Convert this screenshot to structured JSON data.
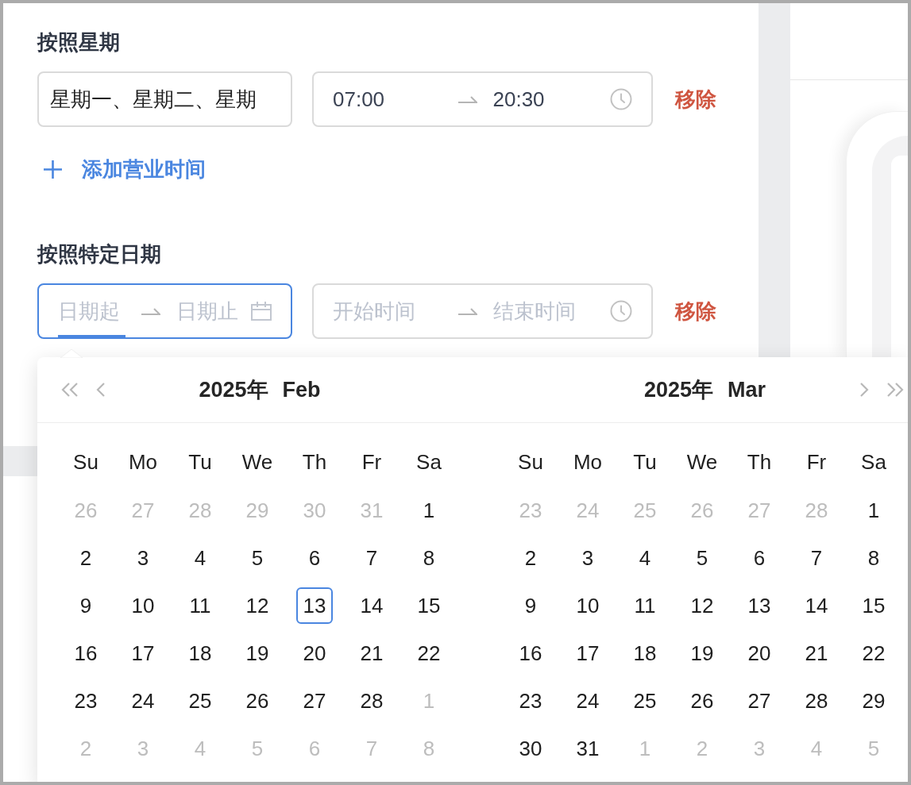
{
  "weekly_hours": {
    "label": "按照星期",
    "days_select": {
      "value": "星期一、星期二、星期"
    },
    "time_range": {
      "focused": false,
      "start": {
        "value": "07:00",
        "active": false
      },
      "end": {
        "value": "20:30",
        "active": false
      }
    },
    "remove": "移除"
  },
  "add_button": {
    "label": "添加营业时间"
  },
  "date_hours": {
    "label": "按照特定日期",
    "date_range": {
      "focused": true,
      "start": {
        "placeholder": "日期起",
        "active": true
      },
      "end": {
        "placeholder": "日期止",
        "active": false
      }
    },
    "time_range": {
      "focused": false,
      "start": {
        "placeholder": "开始时间",
        "active": false
      },
      "end": {
        "placeholder": "结束时间",
        "active": false
      }
    },
    "remove": "移除"
  },
  "calendar": {
    "panels": [
      {
        "year": "2025年",
        "month": "Feb",
        "weekdays": [
          "Su",
          "Mo",
          "Tu",
          "We",
          "Th",
          "Fr",
          "Sa"
        ],
        "weeks": [
          {
            "days": [
              {
                "day": "26",
                "in_month": false,
                "today": false
              },
              {
                "day": "27",
                "in_month": false,
                "today": false
              },
              {
                "day": "28",
                "in_month": false,
                "today": false
              },
              {
                "day": "29",
                "in_month": false,
                "today": false
              },
              {
                "day": "30",
                "in_month": false,
                "today": false
              },
              {
                "day": "31",
                "in_month": false,
                "today": false
              },
              {
                "day": "1",
                "in_month": true,
                "today": false
              }
            ]
          },
          {
            "days": [
              {
                "day": "2",
                "in_month": true,
                "today": false
              },
              {
                "day": "3",
                "in_month": true,
                "today": false
              },
              {
                "day": "4",
                "in_month": true,
                "today": false
              },
              {
                "day": "5",
                "in_month": true,
                "today": false
              },
              {
                "day": "6",
                "in_month": true,
                "today": false
              },
              {
                "day": "7",
                "in_month": true,
                "today": false
              },
              {
                "day": "8",
                "in_month": true,
                "today": false
              }
            ]
          },
          {
            "days": [
              {
                "day": "9",
                "in_month": true,
                "today": false
              },
              {
                "day": "10",
                "in_month": true,
                "today": false
              },
              {
                "day": "11",
                "in_month": true,
                "today": false
              },
              {
                "day": "12",
                "in_month": true,
                "today": false
              },
              {
                "day": "13",
                "in_month": true,
                "today": true
              },
              {
                "day": "14",
                "in_month": true,
                "today": false
              },
              {
                "day": "15",
                "in_month": true,
                "today": false
              }
            ]
          },
          {
            "days": [
              {
                "day": "16",
                "in_month": true,
                "today": false
              },
              {
                "day": "17",
                "in_month": true,
                "today": false
              },
              {
                "day": "18",
                "in_month": true,
                "today": false
              },
              {
                "day": "19",
                "in_month": true,
                "today": false
              },
              {
                "day": "20",
                "in_month": true,
                "today": false
              },
              {
                "day": "21",
                "in_month": true,
                "today": false
              },
              {
                "day": "22",
                "in_month": true,
                "today": false
              }
            ]
          },
          {
            "days": [
              {
                "day": "23",
                "in_month": true,
                "today": false
              },
              {
                "day": "24",
                "in_month": true,
                "today": false
              },
              {
                "day": "25",
                "in_month": true,
                "today": false
              },
              {
                "day": "26",
                "in_month": true,
                "today": false
              },
              {
                "day": "27",
                "in_month": true,
                "today": false
              },
              {
                "day": "28",
                "in_month": true,
                "today": false
              },
              {
                "day": "1",
                "in_month": false,
                "today": false
              }
            ]
          },
          {
            "days": [
              {
                "day": "2",
                "in_month": false,
                "today": false
              },
              {
                "day": "3",
                "in_month": false,
                "today": false
              },
              {
                "day": "4",
                "in_month": false,
                "today": false
              },
              {
                "day": "5",
                "in_month": false,
                "today": false
              },
              {
                "day": "6",
                "in_month": false,
                "today": false
              },
              {
                "day": "7",
                "in_month": false,
                "today": false
              },
              {
                "day": "8",
                "in_month": false,
                "today": false
              }
            ]
          }
        ]
      },
      {
        "year": "2025年",
        "month": "Mar",
        "weekdays": [
          "Su",
          "Mo",
          "Tu",
          "We",
          "Th",
          "Fr",
          "Sa"
        ],
        "weeks": [
          {
            "days": [
              {
                "day": "23",
                "in_month": false,
                "today": false
              },
              {
                "day": "24",
                "in_month": false,
                "today": false
              },
              {
                "day": "25",
                "in_month": false,
                "today": false
              },
              {
                "day": "26",
                "in_month": false,
                "today": false
              },
              {
                "day": "27",
                "in_month": false,
                "today": false
              },
              {
                "day": "28",
                "in_month": false,
                "today": false
              },
              {
                "day": "1",
                "in_month": true,
                "today": false
              }
            ]
          },
          {
            "days": [
              {
                "day": "2",
                "in_month": true,
                "today": false
              },
              {
                "day": "3",
                "in_month": true,
                "today": false
              },
              {
                "day": "4",
                "in_month": true,
                "today": false
              },
              {
                "day": "5",
                "in_month": true,
                "today": false
              },
              {
                "day": "6",
                "in_month": true,
                "today": false
              },
              {
                "day": "7",
                "in_month": true,
                "today": false
              },
              {
                "day": "8",
                "in_month": true,
                "today": false
              }
            ]
          },
          {
            "days": [
              {
                "day": "9",
                "in_month": true,
                "today": false
              },
              {
                "day": "10",
                "in_month": true,
                "today": false
              },
              {
                "day": "11",
                "in_month": true,
                "today": false
              },
              {
                "day": "12",
                "in_month": true,
                "today": false
              },
              {
                "day": "13",
                "in_month": true,
                "today": false
              },
              {
                "day": "14",
                "in_month": true,
                "today": false
              },
              {
                "day": "15",
                "in_month": true,
                "today": false
              }
            ]
          },
          {
            "days": [
              {
                "day": "16",
                "in_month": true,
                "today": false
              },
              {
                "day": "17",
                "in_month": true,
                "today": false
              },
              {
                "day": "18",
                "in_month": true,
                "today": false
              },
              {
                "day": "19",
                "in_month": true,
                "today": false
              },
              {
                "day": "20",
                "in_month": true,
                "today": false
              },
              {
                "day": "21",
                "in_month": true,
                "today": false
              },
              {
                "day": "22",
                "in_month": true,
                "today": false
              }
            ]
          },
          {
            "days": [
              {
                "day": "23",
                "in_month": true,
                "today": false
              },
              {
                "day": "24",
                "in_month": true,
                "today": false
              },
              {
                "day": "25",
                "in_month": true,
                "today": false
              },
              {
                "day": "26",
                "in_month": true,
                "today": false
              },
              {
                "day": "27",
                "in_month": true,
                "today": false
              },
              {
                "day": "28",
                "in_month": true,
                "today": false
              },
              {
                "day": "29",
                "in_month": true,
                "today": false
              }
            ]
          },
          {
            "days": [
              {
                "day": "30",
                "in_month": true,
                "today": false
              },
              {
                "day": "31",
                "in_month": true,
                "today": false
              },
              {
                "day": "1",
                "in_month": false,
                "today": false
              },
              {
                "day": "2",
                "in_month": false,
                "today": false
              },
              {
                "day": "3",
                "in_month": false,
                "today": false
              },
              {
                "day": "4",
                "in_month": false,
                "today": false
              },
              {
                "day": "5",
                "in_month": false,
                "today": false
              }
            ]
          }
        ]
      }
    ]
  }
}
